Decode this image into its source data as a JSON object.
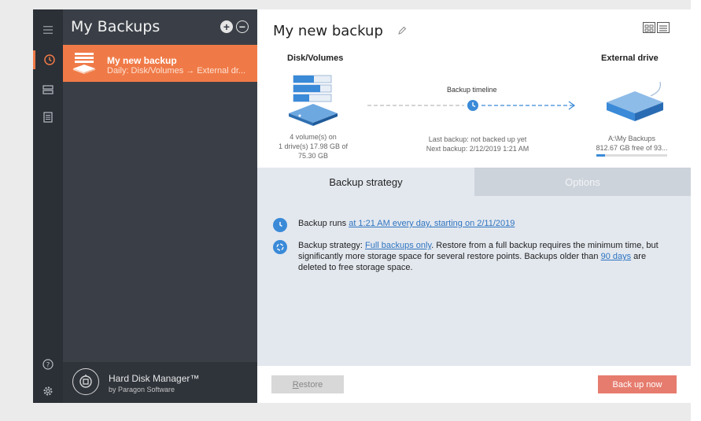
{
  "sidebar": {
    "title": "My Backups",
    "rail_icons": [
      "menu-icon",
      "clock-icon",
      "drives-icon",
      "log-icon",
      "help-icon",
      "settings-icon"
    ],
    "items": [
      {
        "name": "My new backup",
        "subtitle": "Daily: Disk/Volumes → External dr..."
      }
    ],
    "footer": {
      "product": "Hard Disk Manager™",
      "vendor": "by Paragon Software"
    }
  },
  "main": {
    "title": "My new backup",
    "source": {
      "title": "Disk/Volumes",
      "info_lines": [
        "4 volume(s) on",
        "1 drive(s) 17.98 GB of",
        "75.30 GB"
      ]
    },
    "destination": {
      "title": "External drive",
      "info_lines": [
        "A:\\My Backups",
        "812.67 GB free of 93..."
      ],
      "usage_fraction": 0.12
    },
    "timeline": {
      "label": "Backup timeline",
      "last": "Last backup: not backed up yet",
      "next": "Next backup: 2/12/2019 1:21 AM"
    },
    "tabs": [
      {
        "label": "Backup strategy",
        "active": true
      },
      {
        "label": "Options",
        "active": false
      }
    ],
    "schedule": {
      "prefix": "Backup runs ",
      "link": "at 1:21 AM every day, starting on 2/11/2019"
    },
    "strategy": {
      "prefix": "Backup strategy: ",
      "link": "Full backups only",
      "middle": ". Restore from a full backup requires the minimum time, but significantly more storage space for several restore points. Backups older than ",
      "days_link": "90 days",
      "suffix": " are deleted to free storage space."
    },
    "buttons": {
      "restore": "Restore",
      "backup_now": "Back up now"
    }
  },
  "colors": {
    "accent": "#f07a47",
    "link": "#2f74c0",
    "icon_blue": "#3a8ad8",
    "rail": "#2b2f36",
    "panel": "#3a3f47"
  }
}
